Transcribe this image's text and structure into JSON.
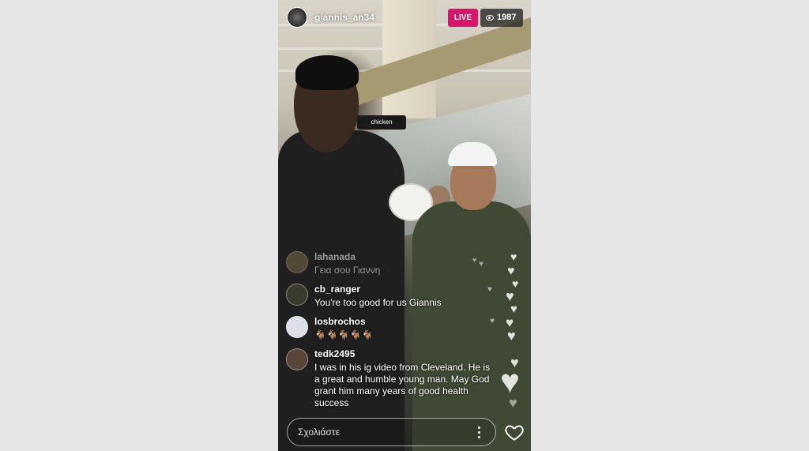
{
  "header": {
    "username": "giannis_an34",
    "live_label": "LIVE",
    "viewer_count": "1987"
  },
  "scene": {
    "sign_text": "chicken"
  },
  "comments": [
    {
      "user": "lahanada",
      "text": "Γεια σου Γιαννη"
    },
    {
      "user": "cb_ranger",
      "text": "You're too good for us Giannis"
    },
    {
      "user": "losbrochos",
      "text": "🐐🐐🐐🐐🐐"
    },
    {
      "user": "tedk2495",
      "text": "I was in his ig video from Cleveland. He is a great and humble young man. May God grant him many years of good health success"
    }
  ],
  "footer": {
    "comment_placeholder": "Σχολιάστε"
  },
  "icons": {
    "viewers": "eye-icon",
    "more": "more-options-icon",
    "like": "heart-icon"
  },
  "colors": {
    "live_badge": "#d9156b",
    "text": "#ffffff"
  }
}
